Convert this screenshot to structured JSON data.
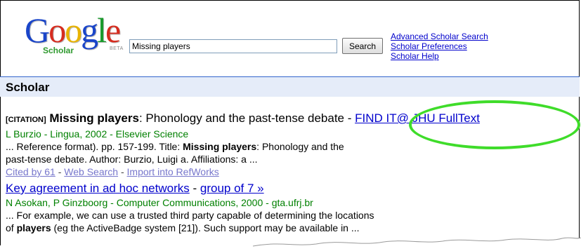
{
  "logo": {
    "letters": [
      "G",
      "o",
      "o",
      "g",
      "l",
      "e"
    ],
    "letter_colors": [
      "#1a45c9",
      "#d62d20",
      "#e8b300",
      "#1a45c9",
      "#1a9a2c",
      "#d62d20"
    ],
    "sub": "Scholar",
    "beta": "BETA"
  },
  "search": {
    "value": "Missing players",
    "button_label": "Search"
  },
  "header_links": [
    "Advanced Scholar Search",
    "Scholar Preferences",
    "Scholar Help"
  ],
  "bar": {
    "title": "Scholar"
  },
  "results": [
    {
      "citation_tag": "[CITATION]",
      "title_bold": "Missing players",
      "title_rest": ": Phonology and the past-tense debate",
      "title_sep": " - ",
      "find_it": "FIND IT@ JHU FullText",
      "authors": "L Burzio - Lingua, 2002 - Elsevier Science",
      "snippet_line1_a": "... Reference format). pp. 157-199. Title: ",
      "snippet_line1_b": "Missing players",
      "snippet_line1_c": ": Phonology and the",
      "snippet_line2": "past-tense debate. Author: Burzio, Luigi a. Affiliations: a ...",
      "actions": [
        "Cited by 61",
        "Web Search",
        "Import into RefWorks"
      ],
      "action_sep": " - "
    },
    {
      "title": "Key agreement in ad hoc networks",
      "title_sep": " - ",
      "group_link": "group of 7 »",
      "authors": "N Asokan, P Ginzboorg - Computer Communications, 2000 - gta.ufrj.br",
      "snippet_line1": "... For example, we can use a trusted third party capable of determining the locations",
      "snippet_line2_a": "of ",
      "snippet_line2_b": "players",
      "snippet_line2_c": " (eg the ActiveBadge system [21]). Such support may be available in ..."
    }
  ],
  "colors": {
    "highlight": "#3fdc2a",
    "link": "#0000cc",
    "visited": "#7777cc",
    "authors": "#008000",
    "bar": "#e5ecf9"
  }
}
